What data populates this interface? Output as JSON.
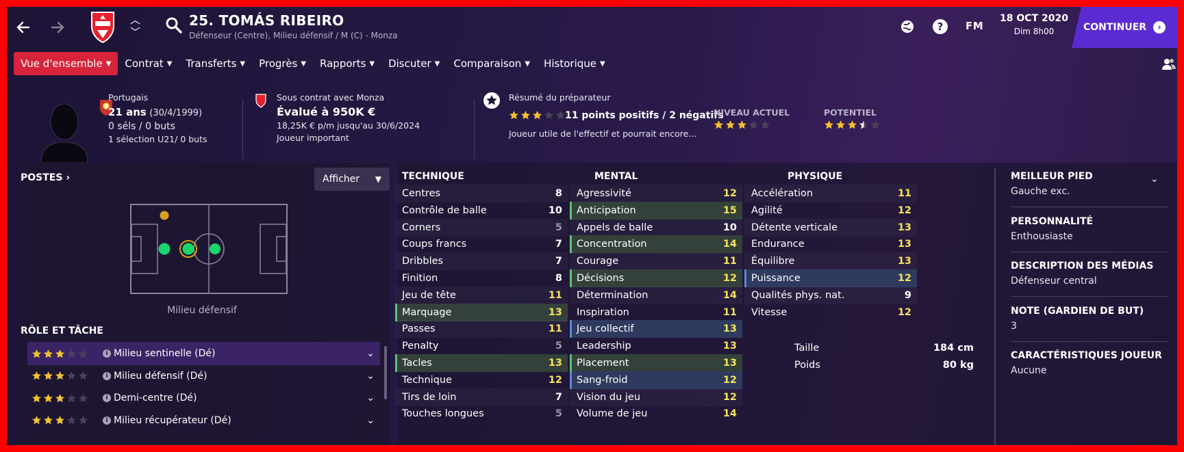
{
  "player": {
    "name": "25. TOMÁS RIBEIRO",
    "subtitle": "Défenseur (Centre), Milieu défensif / M (C) - Monza",
    "club_badge_text": "MONZA"
  },
  "topbar": {
    "fm_logo": "FM",
    "date": "18 OCT 2020",
    "time": "Dim 8h00",
    "continue_label": "CONTINUER",
    "icons": [
      "back-icon",
      "forward-icon",
      "search-icon",
      "globe-icon",
      "help-icon"
    ]
  },
  "tabs": [
    "Vue d'ensemble",
    "Contrat",
    "Transferts",
    "Progrès",
    "Rapports",
    "Discuter",
    "Comparaison",
    "Historique"
  ],
  "info": {
    "nationality": "Portugais",
    "age": "21 ans",
    "birthdate": "(30/4/1999)",
    "caps": "0 séls / 0 buts",
    "u21": "1 sélection U21/ 0 buts",
    "contract_title": "Sous contrat avec Monza",
    "value": "Évalué à 950K €",
    "wage": "18,25K € p/m jusqu'au 30/6/2024",
    "status": "Joueur important",
    "coach_title": "Résumé du préparateur",
    "coach_summary": "11 points positifs / 2 négatifs",
    "coach_stars": 3,
    "coach_text": "Joueur utile de l'effectif et pourrait encore...",
    "current_label": "NIVEAU ACTUEL",
    "current_stars": 3,
    "potential_label": "POTENTIEL",
    "potential_stars": 3.5
  },
  "positions": {
    "title": "POSTES",
    "show_label": "Afficher",
    "pitch_label": "Milieu défensif",
    "roles_title": "RÔLE ET TÂCHE",
    "roles": [
      {
        "name": "Milieu sentinelle (Dé)",
        "stars": 3
      },
      {
        "name": "Milieu défensif (Dé)",
        "stars": 3
      },
      {
        "name": "Demi-centre (Dé)",
        "stars": 3
      },
      {
        "name": "Milieu récupérateur (Dé)",
        "stars": 3
      }
    ]
  },
  "attributes": {
    "technique_title": "TECHNIQUE",
    "mental_title": "MENTAL",
    "physique_title": "PHYSIQUE",
    "technique": [
      {
        "name": "Centres",
        "value": "8",
        "hl": ""
      },
      {
        "name": "Contrôle de balle",
        "value": "10",
        "hl": ""
      },
      {
        "name": "Corners",
        "value": "5",
        "hl": ""
      },
      {
        "name": "Coups francs",
        "value": "7",
        "hl": ""
      },
      {
        "name": "Dribbles",
        "value": "7",
        "hl": ""
      },
      {
        "name": "Finition",
        "value": "8",
        "hl": ""
      },
      {
        "name": "Jeu de tête",
        "value": "11",
        "hl": ""
      },
      {
        "name": "Marquage",
        "value": "13",
        "hl": "green"
      },
      {
        "name": "Passes",
        "value": "11",
        "hl": ""
      },
      {
        "name": "Penalty",
        "value": "5",
        "hl": ""
      },
      {
        "name": "Tacles",
        "value": "13",
        "hl": "green"
      },
      {
        "name": "Technique",
        "value": "12",
        "hl": ""
      },
      {
        "name": "Tirs de loin",
        "value": "7",
        "hl": ""
      },
      {
        "name": "Touches longues",
        "value": "5",
        "hl": ""
      }
    ],
    "mental": [
      {
        "name": "Agressivité",
        "value": "12",
        "hl": ""
      },
      {
        "name": "Anticipation",
        "value": "15",
        "hl": "green"
      },
      {
        "name": "Appels de balle",
        "value": "10",
        "hl": ""
      },
      {
        "name": "Concentration",
        "value": "14",
        "hl": "green"
      },
      {
        "name": "Courage",
        "value": "11",
        "hl": ""
      },
      {
        "name": "Décisions",
        "value": "12",
        "hl": "green"
      },
      {
        "name": "Détermination",
        "value": "14",
        "hl": ""
      },
      {
        "name": "Inspiration",
        "value": "11",
        "hl": ""
      },
      {
        "name": "Jeu collectif",
        "value": "13",
        "hl": "blue"
      },
      {
        "name": "Leadership",
        "value": "13",
        "hl": ""
      },
      {
        "name": "Placement",
        "value": "13",
        "hl": "green"
      },
      {
        "name": "Sang-froid",
        "value": "12",
        "hl": "blue"
      },
      {
        "name": "Vision du jeu",
        "value": "12",
        "hl": ""
      },
      {
        "name": "Volume de jeu",
        "value": "14",
        "hl": ""
      }
    ],
    "physique": [
      {
        "name": "Accélération",
        "value": "11",
        "hl": ""
      },
      {
        "name": "Agilité",
        "value": "12",
        "hl": ""
      },
      {
        "name": "Détente verticale",
        "value": "13",
        "hl": ""
      },
      {
        "name": "Endurance",
        "value": "13",
        "hl": ""
      },
      {
        "name": "Équilibre",
        "value": "13",
        "hl": ""
      },
      {
        "name": "Puissance",
        "value": "12",
        "hl": "blue"
      },
      {
        "name": "Qualités phys. nat.",
        "value": "9",
        "hl": ""
      },
      {
        "name": "Vitesse",
        "value": "12",
        "hl": ""
      }
    ],
    "height_label": "Taille",
    "height_value": "184 cm",
    "weight_label": "Poids",
    "weight_value": "80 kg"
  },
  "details": [
    {
      "title": "MEILLEUR PIED",
      "value": "Gauche exc."
    },
    {
      "title": "PERSONNALITÉ",
      "value": "Enthousiaste"
    },
    {
      "title": "DESCRIPTION DES MÉDIAS",
      "value": "Défenseur central"
    },
    {
      "title": "NOTE (GARDIEN DE BUT)",
      "value": "3"
    },
    {
      "title": "CARACTÉRISTIQUES JOUEUR",
      "value": "Aucune"
    }
  ],
  "colors": {
    "accent": "#d8243a",
    "continue": "#5a2bd0",
    "star": "#f2c230",
    "good": "#5bc46f",
    "pos_green": "#18d66a",
    "pos_gold": "#d6a21e"
  }
}
